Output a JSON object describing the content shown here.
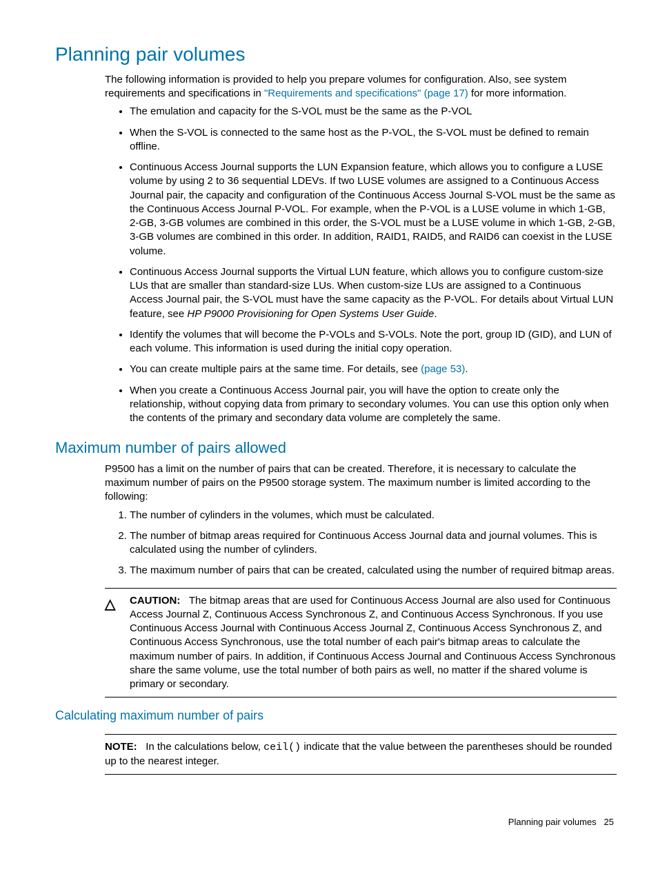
{
  "h1": "Planning pair volumes",
  "intro_pre": "The following information is provided to help you prepare volumes for configuration. Also, see system requirements and specifications in ",
  "intro_link": "\"Requirements and specifications\" (page 17)",
  "intro_post": " for more information.",
  "bullets": {
    "b1": "The emulation and capacity for the S-VOL must be the same as the P-VOL",
    "b2": "When the S-VOL is connected to the same host as the P-VOL, the S-VOL must be defined to remain offline.",
    "b3": "Continuous Access Journal supports the LUN Expansion feature, which allows you to configure a LUSE volume by using 2 to 36 sequential LDEVs. If two LUSE volumes are assigned to a Continuous Access Journal pair, the capacity and configuration of the Continuous Access Journal S-VOL must be the same as the Continuous Access Journal P-VOL. For example, when the P-VOL is a LUSE volume in which 1-GB, 2-GB, 3-GB volumes are combined in this order, the S-VOL must be a LUSE volume in which 1-GB, 2-GB, 3-GB volumes are combined in this order. In addition, RAID1, RAID5, and RAID6 can coexist in the LUSE volume.",
    "b4_pre": "Continuous Access Journal supports the Virtual LUN feature, which allows you to configure custom-size LUs that are smaller than standard-size LUs. When custom-size LUs are assigned to a Continuous Access Journal pair, the S-VOL must have the same capacity as the P-VOL. For details about Virtual LUN feature, see ",
    "b4_italic": "HP P9000 Provisioning for Open Systems User Guide",
    "b4_post": ".",
    "b5": "Identify the volumes that will become the P-VOLs and S-VOLs. Note the port, group ID (GID), and LUN of each volume. This information is used during the initial copy operation.",
    "b6_pre": "You can create multiple pairs at the same time. For details, see ",
    "b6_link": "(page 53)",
    "b6_post": ".",
    "b7": "When you create a Continuous Access Journal pair, you will have the option to create only the relationship, without copying data from primary to secondary volumes. You can use this option only when the contents of the primary and secondary data volume are completely the same."
  },
  "h2_max": "Maximum number of pairs allowed",
  "max_intro": "P9500 has a limit on the number of pairs that can be created. Therefore, it is necessary to calculate the maximum number of pairs on the P9500 storage system. The maximum number is limited according to the following:",
  "max_list": {
    "i1": "The number of cylinders in the volumes, which must be calculated.",
    "i2": "The number of bitmap areas required for Continuous Access Journal data and journal volumes. This is calculated using the number of cylinders.",
    "i3": "The maximum number of pairs that can be created, calculated using the number of required bitmap areas."
  },
  "caution_label": "CAUTION:",
  "caution_icon": "△",
  "caution_body": "The bitmap areas that are used for Continuous Access Journal are also used for Continuous Access Journal Z, Continuous Access Synchronous Z, and Continuous Access Synchronous. If you use Continuous Access Journal with Continuous Access Journal Z, Continuous Access Synchronous Z, and Continuous Access Synchronous, use the total number of each pair's bitmap areas to calculate the maximum number of pairs. In addition, if Continuous Access Journal and Continuous Access Synchronous share the same volume, use the total number of both pairs as well, no matter if the shared volume is primary or secondary.",
  "h3_calc": "Calculating maximum number of pairs",
  "note_label": "NOTE:",
  "note_pre": "In the calculations below, ",
  "note_mono": "ceil()",
  "note_post": " indicate that the value between the parentheses should be rounded up to the nearest integer.",
  "footer_text": "Planning pair volumes",
  "footer_page": "25"
}
